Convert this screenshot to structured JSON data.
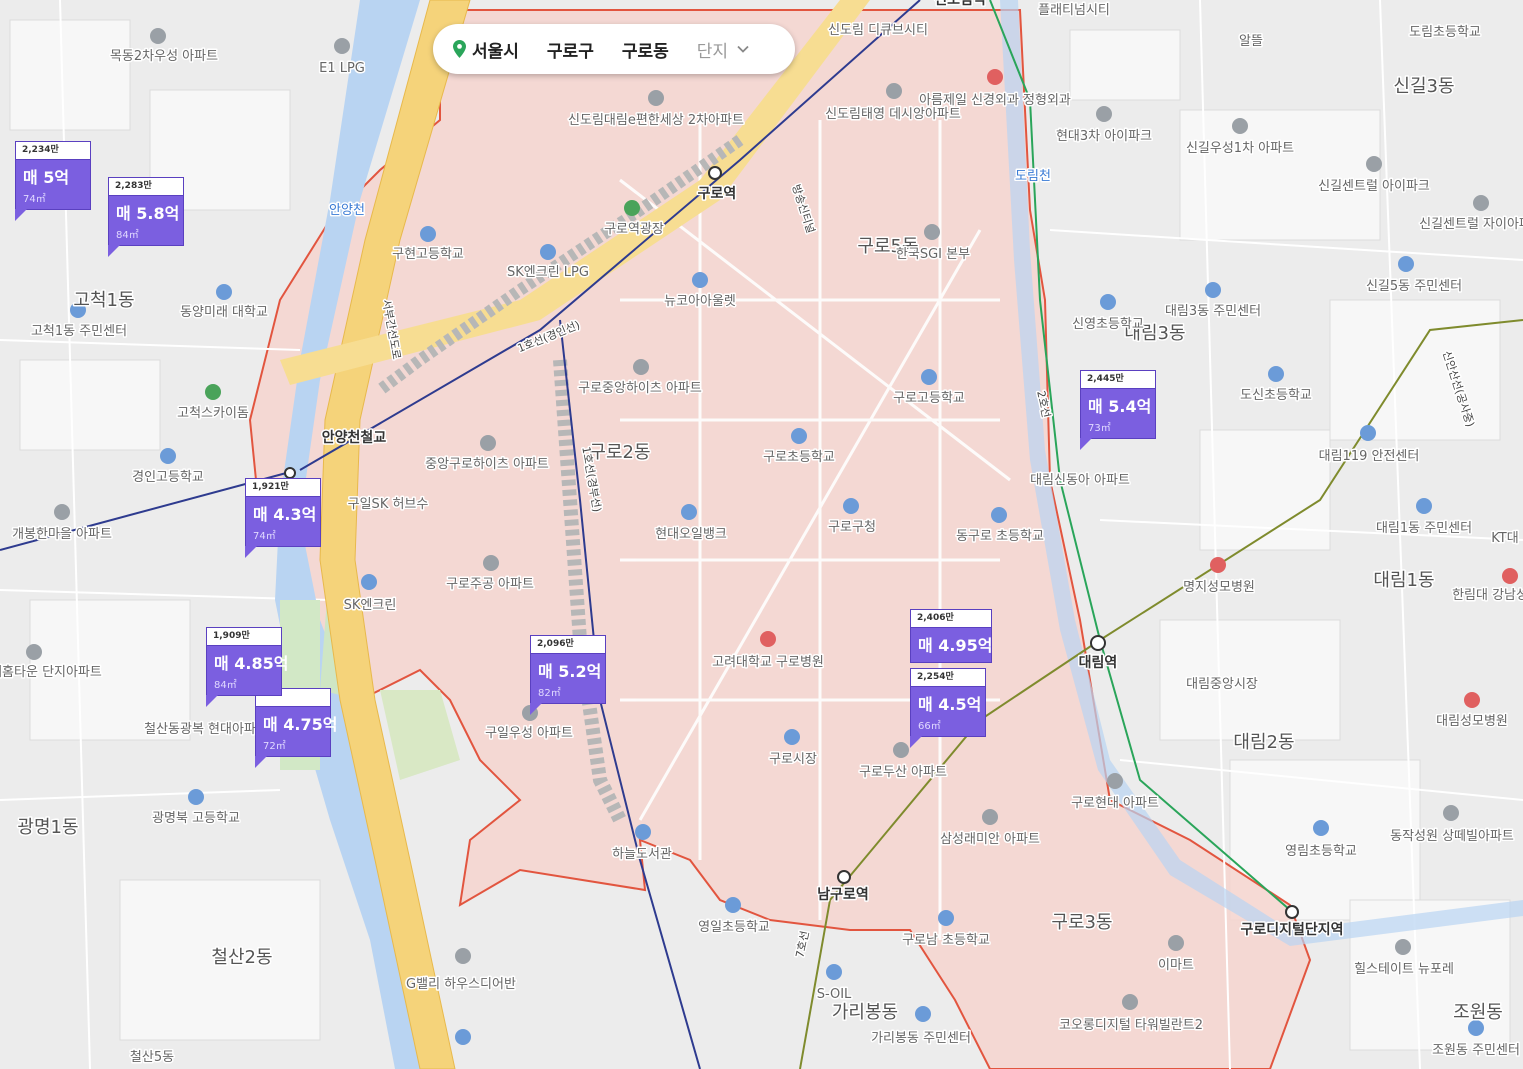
{
  "filter": {
    "city": "서울시",
    "district": "구로구",
    "dong": "구로동",
    "complex_placeholder": "단지"
  },
  "markers": [
    {
      "price_per_area": "2,234만",
      "price": "매 5억",
      "area": "74㎡"
    },
    {
      "price_per_area": "2,283만",
      "price": "매 5.8억",
      "area": "84㎡"
    },
    {
      "price_per_area": "1,921만",
      "price": "매 4.3억",
      "area": "74㎡"
    },
    {
      "price_per_area": "1,909만",
      "price": "매 4.85억",
      "area": "84㎡"
    },
    {
      "price_per_area": "",
      "price": "매 4.75억",
      "area": "72㎡"
    },
    {
      "price_per_area": "2,096만",
      "price": "매 5.2억",
      "area": "82㎡"
    },
    {
      "price_per_area": "2,445만",
      "price": "매 5.4억",
      "area": "73㎡"
    },
    {
      "price_per_area": "2,406만",
      "price": "매 4.95억",
      "area": ""
    },
    {
      "price_per_area": "2,254만",
      "price": "매 4.5억",
      "area": "66㎡"
    }
  ],
  "area_labels": [
    "구로5동",
    "구로2동",
    "구로3동",
    "대림3동",
    "대림1동",
    "대림2동",
    "고척1동",
    "광명1동",
    "철산2동",
    "가리봉동",
    "신길3동",
    "조원동",
    "철산5동"
  ],
  "stations": [
    "구로역",
    "대림역",
    "남구로역",
    "구로디지털단지역",
    "안양천철교",
    "신도림역"
  ],
  "places": [
    "목동2차우성 아파트",
    "E1 LPG",
    "신도림 디큐브시티",
    "플래티넘시티",
    "알뜰",
    "도림초등학교",
    "신도림대림e편한세상 2차아파트",
    "신도림태영 데시앙아파트",
    "아름제일 신경외과 정형외과",
    "현대3차 아이파크",
    "신길우성1차 아파트",
    "신길센트럴 아이파크",
    "신길센트럴 자이아파트",
    "구현고등학교",
    "SK엔크린 LPG",
    "구로역광장",
    "뉴코아아울렛",
    "한국SGI 본부",
    "동양미래 대학교",
    "고척1동 주민센터",
    "고척스카이돔",
    "신영초등학교",
    "대림3동 주민센터",
    "신길5동 주민센터",
    "도신초등학교",
    "구로중앙하이츠 아파트",
    "구로고등학교",
    "경인고등학교",
    "중앙구로하이츠 아파트",
    "구로초등학교",
    "대림신동아 아파트",
    "대림119 안전센터",
    "개봉한마을 아파트",
    "구일SK 허브수",
    "현대오일뱅크",
    "구로구청",
    "동구로 초등학교",
    "대림1동 주민센터",
    "SK엔크린",
    "구로주공 아파트",
    "명지성모병원",
    "한림대 강남성심",
    "현대홈타운 단지아파트",
    "고려대학교 구로병원",
    "대림중앙시장",
    "철산동광복 현대아파트",
    "구일우성 아파트",
    "구로시장",
    "대림성모병원",
    "구로두산 아파트",
    "광명북 고등학교",
    "하늘도서관",
    "구로현대 아파트",
    "삼성래미안 아파트",
    "동작성원 상떼빌아파트",
    "영림초등학교",
    "영일초등학교",
    "구로남 초등학교",
    "이마트",
    "힐스테이트 뉴포레",
    "G밸리 하우스디어반",
    "S-OIL",
    "코오롱디지털 타워빌란트2",
    "가리봉동 주민센터",
    "조원동 주민센터",
    "안양천",
    "도림천",
    "KT대"
  ],
  "roads": [
    "서부간선도로",
    "1호선(경인선)",
    "1호선(경부선)",
    "2호선",
    "7호선",
    "신안산선(공사중)",
    "방송신티널"
  ],
  "colors": {
    "marker_purple": "#7b5fe0",
    "boundary_red": "#e2553f",
    "highlight_fill": "#f6d5cf",
    "highway_yellow": "#f5d37a",
    "river_blue": "#b9d4f2"
  }
}
